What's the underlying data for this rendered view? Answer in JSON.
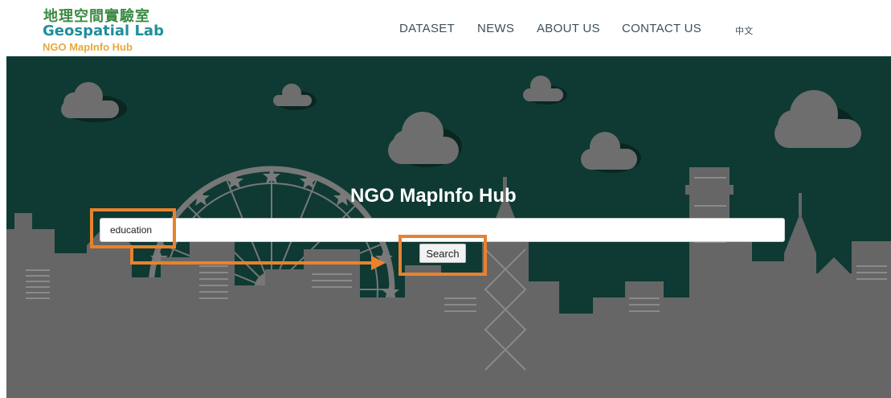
{
  "logo": {
    "chinese": "地理空間實驗室",
    "english": "Geospatial Lab",
    "subtitle": "NGO MapInfo Hub"
  },
  "nav": {
    "items": [
      "DATASET",
      "NEWS",
      "ABOUT US",
      "CONTACT US"
    ],
    "language": "中文"
  },
  "hero": {
    "title": "NGO MapInfo Hub",
    "search_value": "education",
    "search_button": "Search"
  },
  "colors": {
    "hero_background": "#0e3a33",
    "skyline": "#666666",
    "annotation": "#e8822d",
    "logo_green": "#3b8a43",
    "logo_teal": "#1f8f9c",
    "logo_orange": "#e8a93a"
  }
}
